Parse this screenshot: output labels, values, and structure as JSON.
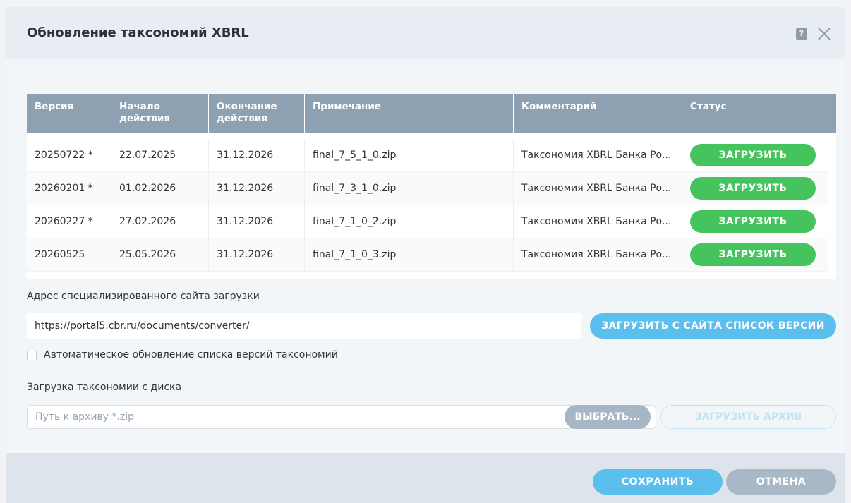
{
  "dialog": {
    "title": "Обновление таксономий XBRL",
    "help_icon": "?"
  },
  "table": {
    "headers": [
      "Версия",
      "Начало действия",
      "Окончание действия",
      "Примечание",
      "Комментарий",
      "Статус"
    ],
    "rows": [
      {
        "version": "20250722 *",
        "start": "22.07.2025",
        "end": "31.12.2026",
        "note": "final_7_5_1_0.zip",
        "comment": "Таксономия XBRL Банка Ро...",
        "status": "ЗАГРУЗИТЬ"
      },
      {
        "version": "20260201 *",
        "start": "01.02.2026",
        "end": "31.12.2026",
        "note": "final_7_3_1_0.zip",
        "comment": "Таксономия XBRL Банка Ро...",
        "status": "ЗАГРУЗИТЬ"
      },
      {
        "version": "20260227 *",
        "start": "27.02.2026",
        "end": "31.12.2026",
        "note": "final_7_1_0_2.zip",
        "comment": "Таксономия XBRL Банка Ро...",
        "status": "ЗАГРУЗИТЬ"
      },
      {
        "version": "20260525",
        "start": "25.05.2026",
        "end": "31.12.2026",
        "note": "final_7_1_0_3.zip",
        "comment": "Таксономия XBRL Банка Ро...",
        "status": "ЗАГРУЗИТЬ"
      }
    ]
  },
  "site": {
    "label": "Адрес специализированного сайта загрузки",
    "url": "https://portal5.cbr.ru/documents/converter/",
    "load_button": "ЗАГРУЗИТЬ С САЙТА СПИСОК ВЕРСИЙ"
  },
  "auto_update": {
    "label": "Автоматическое обновление списка версий таксономий",
    "checked": false
  },
  "disk": {
    "label": "Загрузка таксономии с диска",
    "placeholder": "Путь к архиву *.zip",
    "choose_button": "ВЫБРАТЬ...",
    "upload_button": "ЗАГРУЗИТЬ АРХИВ"
  },
  "footer": {
    "save": "СОХРАНИТЬ",
    "cancel": "ОТМЕНА"
  },
  "colors": {
    "header_bg": "#8da1b3",
    "green": "#45c35c",
    "blue": "#5bbfee",
    "gray_button": "#a9b8c6"
  }
}
